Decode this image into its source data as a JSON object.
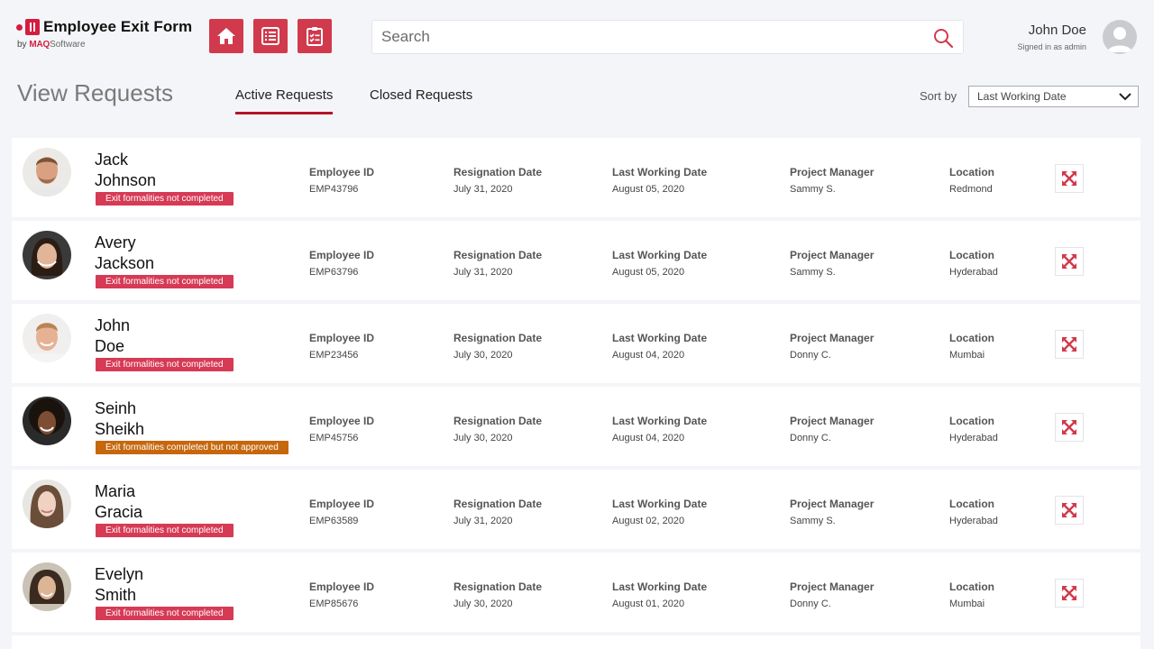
{
  "app": {
    "title": "Employee Exit Form",
    "by": "by",
    "brand": "MAQ",
    "brand_suffix": "Software"
  },
  "nav": [
    {
      "name": "home-button",
      "icon": "home-icon"
    },
    {
      "name": "list-button",
      "icon": "list-icon"
    },
    {
      "name": "checklist-button",
      "icon": "clipboard-check-icon"
    }
  ],
  "search": {
    "placeholder": "Search",
    "value": ""
  },
  "user": {
    "name": "John Doe",
    "role": "Signed in as admin"
  },
  "page": {
    "title": "View Requests",
    "tabs": [
      {
        "label": "Active Requests",
        "active": true
      },
      {
        "label": "Closed Requests",
        "active": false
      }
    ],
    "sort_label": "Sort by",
    "sort_value": "Last Working Date"
  },
  "columns": {
    "employee_id": "Employee ID",
    "resignation_date": "Resignation Date",
    "last_working_date": "Last Working Date",
    "project_manager": "Project Manager",
    "location": "Location"
  },
  "colors": {
    "accent": "#d13a4c",
    "badge_red": "#d63a55",
    "badge_orange": "#c6670d"
  },
  "requests": [
    {
      "first": "Jack",
      "last": "Johnson",
      "status": "Exit formalities not completed",
      "status_type": "red",
      "employee_id": "EMP43796",
      "resignation_date": "July 31, 2020",
      "last_working_date": "August 05, 2020",
      "project_manager": "Sammy S.",
      "location": "Redmond"
    },
    {
      "first": "Avery",
      "last": "Jackson",
      "status": "Exit formalities not completed",
      "status_type": "red",
      "employee_id": "EMP63796",
      "resignation_date": "July 31, 2020",
      "last_working_date": "August 05, 2020",
      "project_manager": "Sammy S.",
      "location": "Hyderabad"
    },
    {
      "first": "John",
      "last": "Doe",
      "status": "Exit formalities not completed",
      "status_type": "red",
      "employee_id": "EMP23456",
      "resignation_date": "July 30, 2020",
      "last_working_date": "August 04, 2020",
      "project_manager": "Donny C.",
      "location": "Mumbai"
    },
    {
      "first": "Seinh",
      "last": "Sheikh",
      "status": "Exit formalities completed but not approved",
      "status_type": "orange",
      "employee_id": "EMP45756",
      "resignation_date": "July 30, 2020",
      "last_working_date": "August 04, 2020",
      "project_manager": "Donny C.",
      "location": "Hyderabad"
    },
    {
      "first": "Maria",
      "last": "Gracia",
      "status": "Exit formalities not completed",
      "status_type": "red",
      "employee_id": "EMP63589",
      "resignation_date": "July 31, 2020",
      "last_working_date": "August 02, 2020",
      "project_manager": "Sammy S.",
      "location": "Hyderabad"
    },
    {
      "first": "Evelyn",
      "last": "Smith",
      "status": "Exit formalities not completed",
      "status_type": "red",
      "employee_id": "EMP85676",
      "resignation_date": "July 30, 2020",
      "last_working_date": "August 01, 2020",
      "project_manager": "Donny C.",
      "location": "Mumbai"
    }
  ]
}
